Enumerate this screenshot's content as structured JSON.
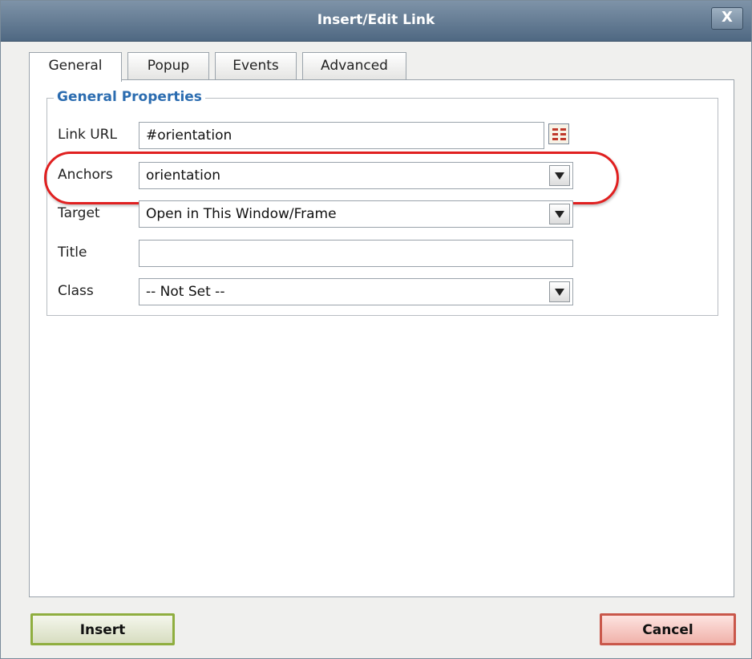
{
  "window": {
    "title": "Insert/Edit Link",
    "close_label": "X"
  },
  "tabs": [
    {
      "label": "General",
      "active": true
    },
    {
      "label": "Popup",
      "active": false
    },
    {
      "label": "Events",
      "active": false
    },
    {
      "label": "Advanced",
      "active": false
    }
  ],
  "general": {
    "legend": "General Properties",
    "link_url": {
      "label": "Link URL",
      "value": "#orientation",
      "browse_icon": "browse-icon"
    },
    "anchors": {
      "label": "Anchors",
      "value": "orientation"
    },
    "target": {
      "label": "Target",
      "value": "Open in This Window/Frame"
    },
    "title": {
      "label": "Title",
      "value": ""
    },
    "class": {
      "label": "Class",
      "value": "-- Not Set --"
    }
  },
  "buttons": {
    "insert": "Insert",
    "cancel": "Cancel"
  },
  "colors": {
    "titlebar": "#5f7891",
    "legend": "#2b6cb0",
    "highlight": "#e02020",
    "insert_border": "#8fae3f",
    "cancel_border": "#c9574a"
  }
}
